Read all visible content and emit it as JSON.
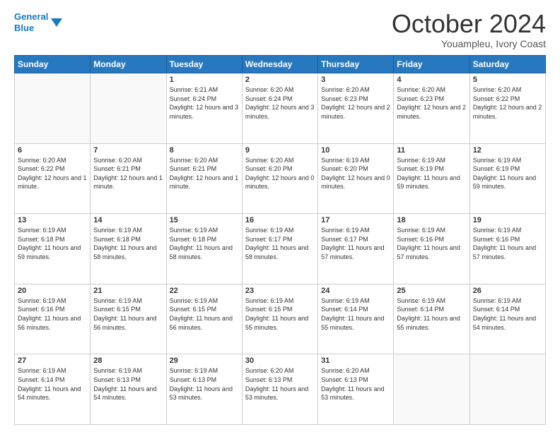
{
  "logo": {
    "line1": "General",
    "line2": "Blue"
  },
  "header": {
    "month": "October 2024",
    "location": "Youampleu, Ivory Coast"
  },
  "weekdays": [
    "Sunday",
    "Monday",
    "Tuesday",
    "Wednesday",
    "Thursday",
    "Friday",
    "Saturday"
  ],
  "weeks": [
    [
      {
        "day": "",
        "info": ""
      },
      {
        "day": "",
        "info": ""
      },
      {
        "day": "1",
        "info": "Sunrise: 6:21 AM\nSunset: 6:24 PM\nDaylight: 12 hours and 3 minutes."
      },
      {
        "day": "2",
        "info": "Sunrise: 6:20 AM\nSunset: 6:24 PM\nDaylight: 12 hours and 3 minutes."
      },
      {
        "day": "3",
        "info": "Sunrise: 6:20 AM\nSunset: 6:23 PM\nDaylight: 12 hours and 2 minutes."
      },
      {
        "day": "4",
        "info": "Sunrise: 6:20 AM\nSunset: 6:23 PM\nDaylight: 12 hours and 2 minutes."
      },
      {
        "day": "5",
        "info": "Sunrise: 6:20 AM\nSunset: 6:22 PM\nDaylight: 12 hours and 2 minutes."
      }
    ],
    [
      {
        "day": "6",
        "info": "Sunrise: 6:20 AM\nSunset: 6:22 PM\nDaylight: 12 hours and 1 minute."
      },
      {
        "day": "7",
        "info": "Sunrise: 6:20 AM\nSunset: 6:21 PM\nDaylight: 12 hours and 1 minute."
      },
      {
        "day": "8",
        "info": "Sunrise: 6:20 AM\nSunset: 6:21 PM\nDaylight: 12 hours and 1 minute."
      },
      {
        "day": "9",
        "info": "Sunrise: 6:20 AM\nSunset: 6:20 PM\nDaylight: 12 hours and 0 minutes."
      },
      {
        "day": "10",
        "info": "Sunrise: 6:19 AM\nSunset: 6:20 PM\nDaylight: 12 hours and 0 minutes."
      },
      {
        "day": "11",
        "info": "Sunrise: 6:19 AM\nSunset: 6:19 PM\nDaylight: 11 hours and 59 minutes."
      },
      {
        "day": "12",
        "info": "Sunrise: 6:19 AM\nSunset: 6:19 PM\nDaylight: 11 hours and 59 minutes."
      }
    ],
    [
      {
        "day": "13",
        "info": "Sunrise: 6:19 AM\nSunset: 6:18 PM\nDaylight: 11 hours and 59 minutes."
      },
      {
        "day": "14",
        "info": "Sunrise: 6:19 AM\nSunset: 6:18 PM\nDaylight: 11 hours and 58 minutes."
      },
      {
        "day": "15",
        "info": "Sunrise: 6:19 AM\nSunset: 6:18 PM\nDaylight: 11 hours and 58 minutes."
      },
      {
        "day": "16",
        "info": "Sunrise: 6:19 AM\nSunset: 6:17 PM\nDaylight: 11 hours and 58 minutes."
      },
      {
        "day": "17",
        "info": "Sunrise: 6:19 AM\nSunset: 6:17 PM\nDaylight: 11 hours and 57 minutes."
      },
      {
        "day": "18",
        "info": "Sunrise: 6:19 AM\nSunset: 6:16 PM\nDaylight: 11 hours and 57 minutes."
      },
      {
        "day": "19",
        "info": "Sunrise: 6:19 AM\nSunset: 6:16 PM\nDaylight: 11 hours and 57 minutes."
      }
    ],
    [
      {
        "day": "20",
        "info": "Sunrise: 6:19 AM\nSunset: 6:16 PM\nDaylight: 11 hours and 56 minutes."
      },
      {
        "day": "21",
        "info": "Sunrise: 6:19 AM\nSunset: 6:15 PM\nDaylight: 11 hours and 56 minutes."
      },
      {
        "day": "22",
        "info": "Sunrise: 6:19 AM\nSunset: 6:15 PM\nDaylight: 11 hours and 56 minutes."
      },
      {
        "day": "23",
        "info": "Sunrise: 6:19 AM\nSunset: 6:15 PM\nDaylight: 11 hours and 55 minutes."
      },
      {
        "day": "24",
        "info": "Sunrise: 6:19 AM\nSunset: 6:14 PM\nDaylight: 11 hours and 55 minutes."
      },
      {
        "day": "25",
        "info": "Sunrise: 6:19 AM\nSunset: 6:14 PM\nDaylight: 11 hours and 55 minutes."
      },
      {
        "day": "26",
        "info": "Sunrise: 6:19 AM\nSunset: 6:14 PM\nDaylight: 11 hours and 54 minutes."
      }
    ],
    [
      {
        "day": "27",
        "info": "Sunrise: 6:19 AM\nSunset: 6:14 PM\nDaylight: 11 hours and 54 minutes."
      },
      {
        "day": "28",
        "info": "Sunrise: 6:19 AM\nSunset: 6:13 PM\nDaylight: 11 hours and 54 minutes."
      },
      {
        "day": "29",
        "info": "Sunrise: 6:19 AM\nSunset: 6:13 PM\nDaylight: 11 hours and 53 minutes."
      },
      {
        "day": "30",
        "info": "Sunrise: 6:20 AM\nSunset: 6:13 PM\nDaylight: 11 hours and 53 minutes."
      },
      {
        "day": "31",
        "info": "Sunrise: 6:20 AM\nSunset: 6:13 PM\nDaylight: 11 hours and 53 minutes."
      },
      {
        "day": "",
        "info": ""
      },
      {
        "day": "",
        "info": ""
      }
    ]
  ]
}
